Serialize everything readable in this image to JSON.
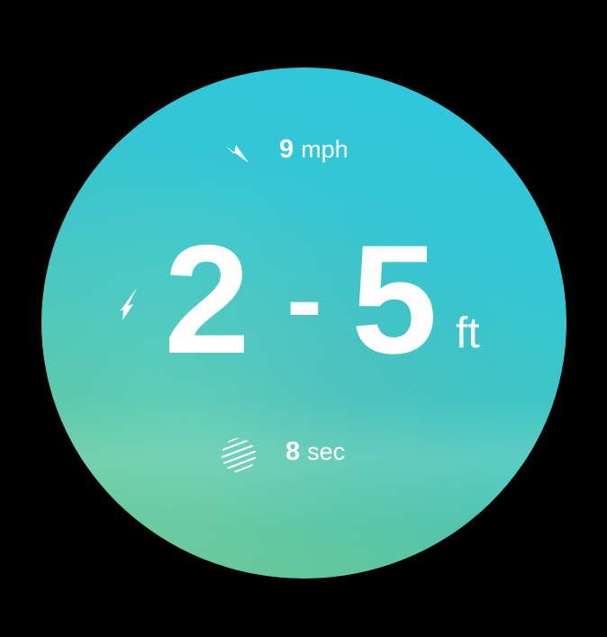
{
  "wind": {
    "icon": "wind-direction-arrow-icon",
    "value": "9",
    "unit": "mph"
  },
  "swell": {
    "icon": "swell-direction-arrow-icon",
    "low": "2",
    "separator": "-",
    "high": "5",
    "unit": "ft"
  },
  "period": {
    "icon": "wave-period-icon",
    "value": "8",
    "unit": "sec"
  },
  "colors": {
    "background": "#000000",
    "face_top": "#2ec7df",
    "face_bottom": "#6cc48a",
    "text": "#ffffff"
  }
}
